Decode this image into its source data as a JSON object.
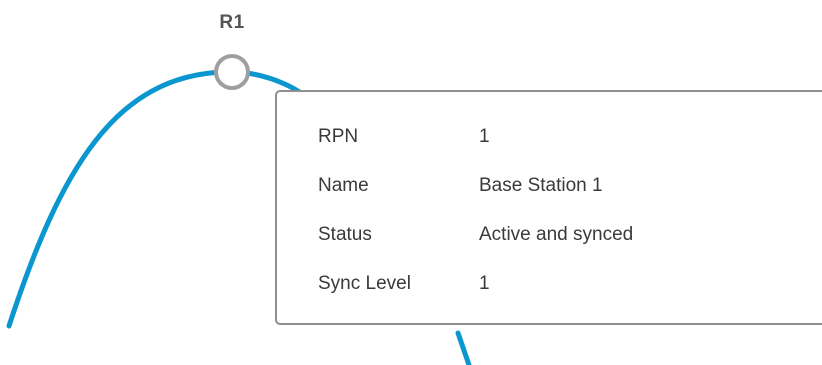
{
  "colors": {
    "link_line": "#0a97cf",
    "node_stroke": "#9e9e9e",
    "node_fill": "#ffffff",
    "tooltip_border": "#8f8f8f",
    "text": "#3a3a3a",
    "node_label": "#555555"
  },
  "topology": {
    "node": {
      "label": "R1",
      "icon": "node-circle-icon"
    }
  },
  "tooltip": {
    "fields": [
      {
        "label": "RPN",
        "value": "1"
      },
      {
        "label": "Name",
        "value": "Base Station 1"
      },
      {
        "label": "Status",
        "value": "Active and synced"
      },
      {
        "label": "Sync Level",
        "value": "1"
      }
    ]
  }
}
